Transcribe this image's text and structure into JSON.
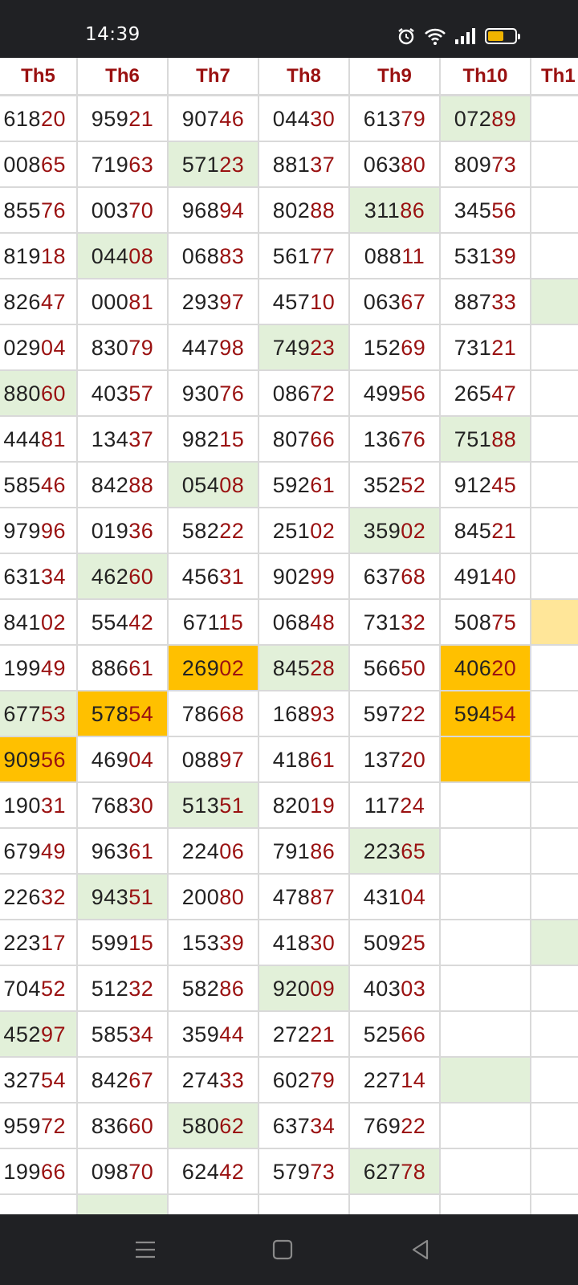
{
  "status_bar": {
    "time": "14:39",
    "battery_level": 0.6
  },
  "columns": [
    "Th5",
    "Th6",
    "Th7",
    "Th8",
    "Th9",
    "Th10",
    "Th1"
  ],
  "rows": [
    {
      "cells": [
        {
          "a": "618",
          "b": "20"
        },
        {
          "a": "959",
          "b": "21"
        },
        {
          "a": "907",
          "b": "46"
        },
        {
          "a": "044",
          "b": "30"
        },
        {
          "a": "613",
          "b": "79"
        },
        {
          "a": "072",
          "b": "89",
          "hl": "g"
        },
        {
          "a": "",
          "b": ""
        }
      ]
    },
    {
      "cells": [
        {
          "a": "008",
          "b": "65"
        },
        {
          "a": "719",
          "b": "63"
        },
        {
          "a": "571",
          "b": "23",
          "hl": "g"
        },
        {
          "a": "881",
          "b": "37"
        },
        {
          "a": "063",
          "b": "80"
        },
        {
          "a": "809",
          "b": "73"
        },
        {
          "a": "",
          "b": ""
        }
      ]
    },
    {
      "cells": [
        {
          "a": "855",
          "b": "76"
        },
        {
          "a": "003",
          "b": "70"
        },
        {
          "a": "968",
          "b": "94"
        },
        {
          "a": "802",
          "b": "88"
        },
        {
          "a": "311",
          "b": "86",
          "hl": "g"
        },
        {
          "a": "345",
          "b": "56"
        },
        {
          "a": "",
          "b": ""
        }
      ]
    },
    {
      "cells": [
        {
          "a": "819",
          "b": "18"
        },
        {
          "a": "044",
          "b": "08",
          "hl": "g"
        },
        {
          "a": "068",
          "b": "83"
        },
        {
          "a": "561",
          "b": "77"
        },
        {
          "a": "088",
          "b": "11"
        },
        {
          "a": "531",
          "b": "39"
        },
        {
          "a": "",
          "b": ""
        }
      ]
    },
    {
      "cells": [
        {
          "a": "826",
          "b": "47"
        },
        {
          "a": "000",
          "b": "81"
        },
        {
          "a": "293",
          "b": "97"
        },
        {
          "a": "457",
          "b": "10"
        },
        {
          "a": "063",
          "b": "67"
        },
        {
          "a": "887",
          "b": "33"
        },
        {
          "a": "",
          "b": "",
          "hl": "g"
        }
      ]
    },
    {
      "cells": [
        {
          "a": "029",
          "b": "04"
        },
        {
          "a": "830",
          "b": "79"
        },
        {
          "a": "447",
          "b": "98"
        },
        {
          "a": "749",
          "b": "23",
          "hl": "g"
        },
        {
          "a": "152",
          "b": "69"
        },
        {
          "a": "731",
          "b": "21"
        },
        {
          "a": "",
          "b": ""
        }
      ]
    },
    {
      "cells": [
        {
          "a": "880",
          "b": "60",
          "hl": "g"
        },
        {
          "a": "403",
          "b": "57"
        },
        {
          "a": "930",
          "b": "76"
        },
        {
          "a": "086",
          "b": "72"
        },
        {
          "a": "499",
          "b": "56"
        },
        {
          "a": "265",
          "b": "47"
        },
        {
          "a": "",
          "b": ""
        }
      ]
    },
    {
      "cells": [
        {
          "a": "444",
          "b": "81"
        },
        {
          "a": "134",
          "b": "37"
        },
        {
          "a": "982",
          "b": "15"
        },
        {
          "a": "807",
          "b": "66"
        },
        {
          "a": "136",
          "b": "76"
        },
        {
          "a": "751",
          "b": "88",
          "hl": "g"
        },
        {
          "a": "",
          "b": ""
        }
      ]
    },
    {
      "cells": [
        {
          "a": "585",
          "b": "46"
        },
        {
          "a": "842",
          "b": "88"
        },
        {
          "a": "054",
          "b": "08",
          "hl": "g"
        },
        {
          "a": "592",
          "b": "61"
        },
        {
          "a": "352",
          "b": "52"
        },
        {
          "a": "912",
          "b": "45"
        },
        {
          "a": "",
          "b": ""
        }
      ]
    },
    {
      "cells": [
        {
          "a": "979",
          "b": "96"
        },
        {
          "a": "019",
          "b": "36"
        },
        {
          "a": "582",
          "b": "22"
        },
        {
          "a": "251",
          "b": "02"
        },
        {
          "a": "359",
          "b": "02",
          "hl": "g"
        },
        {
          "a": "845",
          "b": "21"
        },
        {
          "a": "",
          "b": ""
        }
      ]
    },
    {
      "cells": [
        {
          "a": "631",
          "b": "34"
        },
        {
          "a": "462",
          "b": "60",
          "hl": "g"
        },
        {
          "a": "456",
          "b": "31"
        },
        {
          "a": "902",
          "b": "99"
        },
        {
          "a": "637",
          "b": "68"
        },
        {
          "a": "491",
          "b": "40"
        },
        {
          "a": "",
          "b": ""
        }
      ]
    },
    {
      "cells": [
        {
          "a": "841",
          "b": "02"
        },
        {
          "a": "554",
          "b": "42"
        },
        {
          "a": "671",
          "b": "15"
        },
        {
          "a": "068",
          "b": "48"
        },
        {
          "a": "731",
          "b": "32"
        },
        {
          "a": "508",
          "b": "75"
        },
        {
          "a": "",
          "b": "",
          "hl": "y"
        }
      ]
    },
    {
      "cells": [
        {
          "a": "199",
          "b": "49"
        },
        {
          "a": "886",
          "b": "61"
        },
        {
          "a": "269",
          "b": "02",
          "hl": "o"
        },
        {
          "a": "845",
          "b": "28",
          "hl": "g"
        },
        {
          "a": "566",
          "b": "50"
        },
        {
          "a": "406",
          "b": "20",
          "hl": "o"
        },
        {
          "a": "",
          "b": ""
        }
      ]
    },
    {
      "cells": [
        {
          "a": "677",
          "b": "53",
          "hl": "g"
        },
        {
          "a": "578",
          "b": "54",
          "hl": "o"
        },
        {
          "a": "786",
          "b": "68"
        },
        {
          "a": "168",
          "b": "93"
        },
        {
          "a": "597",
          "b": "22"
        },
        {
          "a": "594",
          "b": "54",
          "hl": "o"
        },
        {
          "a": "",
          "b": ""
        }
      ]
    },
    {
      "cells": [
        {
          "a": "909",
          "b": "56",
          "hl": "o"
        },
        {
          "a": "469",
          "b": "04"
        },
        {
          "a": "088",
          "b": "97"
        },
        {
          "a": "418",
          "b": "61"
        },
        {
          "a": "137",
          "b": "20"
        },
        {
          "a": "",
          "b": "",
          "hl": "o"
        },
        {
          "a": "",
          "b": ""
        }
      ]
    },
    {
      "cells": [
        {
          "a": "190",
          "b": "31"
        },
        {
          "a": "768",
          "b": "30"
        },
        {
          "a": "513",
          "b": "51",
          "hl": "g"
        },
        {
          "a": "820",
          "b": "19"
        },
        {
          "a": "117",
          "b": "24"
        },
        {
          "a": "",
          "b": ""
        },
        {
          "a": "",
          "b": ""
        }
      ]
    },
    {
      "cells": [
        {
          "a": "679",
          "b": "49"
        },
        {
          "a": "963",
          "b": "61"
        },
        {
          "a": "224",
          "b": "06"
        },
        {
          "a": "791",
          "b": "86"
        },
        {
          "a": "223",
          "b": "65",
          "hl": "g"
        },
        {
          "a": "",
          "b": ""
        },
        {
          "a": "",
          "b": ""
        }
      ]
    },
    {
      "cells": [
        {
          "a": "226",
          "b": "32"
        },
        {
          "a": "943",
          "b": "51",
          "hl": "g"
        },
        {
          "a": "200",
          "b": "80"
        },
        {
          "a": "478",
          "b": "87"
        },
        {
          "a": "431",
          "b": "04"
        },
        {
          "a": "",
          "b": ""
        },
        {
          "a": "",
          "b": ""
        }
      ]
    },
    {
      "cells": [
        {
          "a": "223",
          "b": "17"
        },
        {
          "a": "599",
          "b": "15"
        },
        {
          "a": "153",
          "b": "39"
        },
        {
          "a": "418",
          "b": "30"
        },
        {
          "a": "509",
          "b": "25"
        },
        {
          "a": "",
          "b": ""
        },
        {
          "a": "",
          "b": "",
          "hl": "g"
        }
      ]
    },
    {
      "cells": [
        {
          "a": "704",
          "b": "52"
        },
        {
          "a": "512",
          "b": "32"
        },
        {
          "a": "582",
          "b": "86"
        },
        {
          "a": "920",
          "b": "09",
          "hl": "g"
        },
        {
          "a": "403",
          "b": "03"
        },
        {
          "a": "",
          "b": ""
        },
        {
          "a": "",
          "b": ""
        }
      ]
    },
    {
      "cells": [
        {
          "a": "452",
          "b": "97",
          "hl": "g"
        },
        {
          "a": "585",
          "b": "34"
        },
        {
          "a": "359",
          "b": "44"
        },
        {
          "a": "272",
          "b": "21"
        },
        {
          "a": "525",
          "b": "66"
        },
        {
          "a": "",
          "b": ""
        },
        {
          "a": "",
          "b": ""
        }
      ]
    },
    {
      "cells": [
        {
          "a": "327",
          "b": "54"
        },
        {
          "a": "842",
          "b": "67"
        },
        {
          "a": "274",
          "b": "33"
        },
        {
          "a": "602",
          "b": "79"
        },
        {
          "a": "227",
          "b": "14"
        },
        {
          "a": "",
          "b": "",
          "hl": "g"
        },
        {
          "a": "",
          "b": ""
        }
      ]
    },
    {
      "cells": [
        {
          "a": "959",
          "b": "72"
        },
        {
          "a": "836",
          "b": "60"
        },
        {
          "a": "580",
          "b": "62",
          "hl": "g"
        },
        {
          "a": "637",
          "b": "34"
        },
        {
          "a": "769",
          "b": "22"
        },
        {
          "a": "",
          "b": ""
        },
        {
          "a": "",
          "b": ""
        }
      ]
    },
    {
      "cells": [
        {
          "a": "199",
          "b": "66"
        },
        {
          "a": "098",
          "b": "70"
        },
        {
          "a": "624",
          "b": "42"
        },
        {
          "a": "579",
          "b": "73"
        },
        {
          "a": "627",
          "b": "78",
          "hl": "g"
        },
        {
          "a": "",
          "b": ""
        },
        {
          "a": "",
          "b": ""
        }
      ]
    },
    {
      "cells": [
        {
          "a": "",
          "b": ""
        },
        {
          "a": "",
          "b": "",
          "hl": "g"
        },
        {
          "a": "",
          "b": ""
        },
        {
          "a": "",
          "b": ""
        },
        {
          "a": "",
          "b": ""
        },
        {
          "a": "",
          "b": ""
        },
        {
          "a": "",
          "b": ""
        }
      ]
    }
  ],
  "colors": {
    "header_text": "#9a1111",
    "green_highlight": "#e2f0d9",
    "orange_highlight": "#ffc000",
    "yellow_highlight": "#ffe699"
  },
  "icons": {
    "alarm": "alarm-icon",
    "wifi": "wifi-icon",
    "signal": "signal-icon",
    "battery": "battery-icon",
    "menu": "menu-icon",
    "home": "home-icon",
    "back": "back-icon"
  }
}
